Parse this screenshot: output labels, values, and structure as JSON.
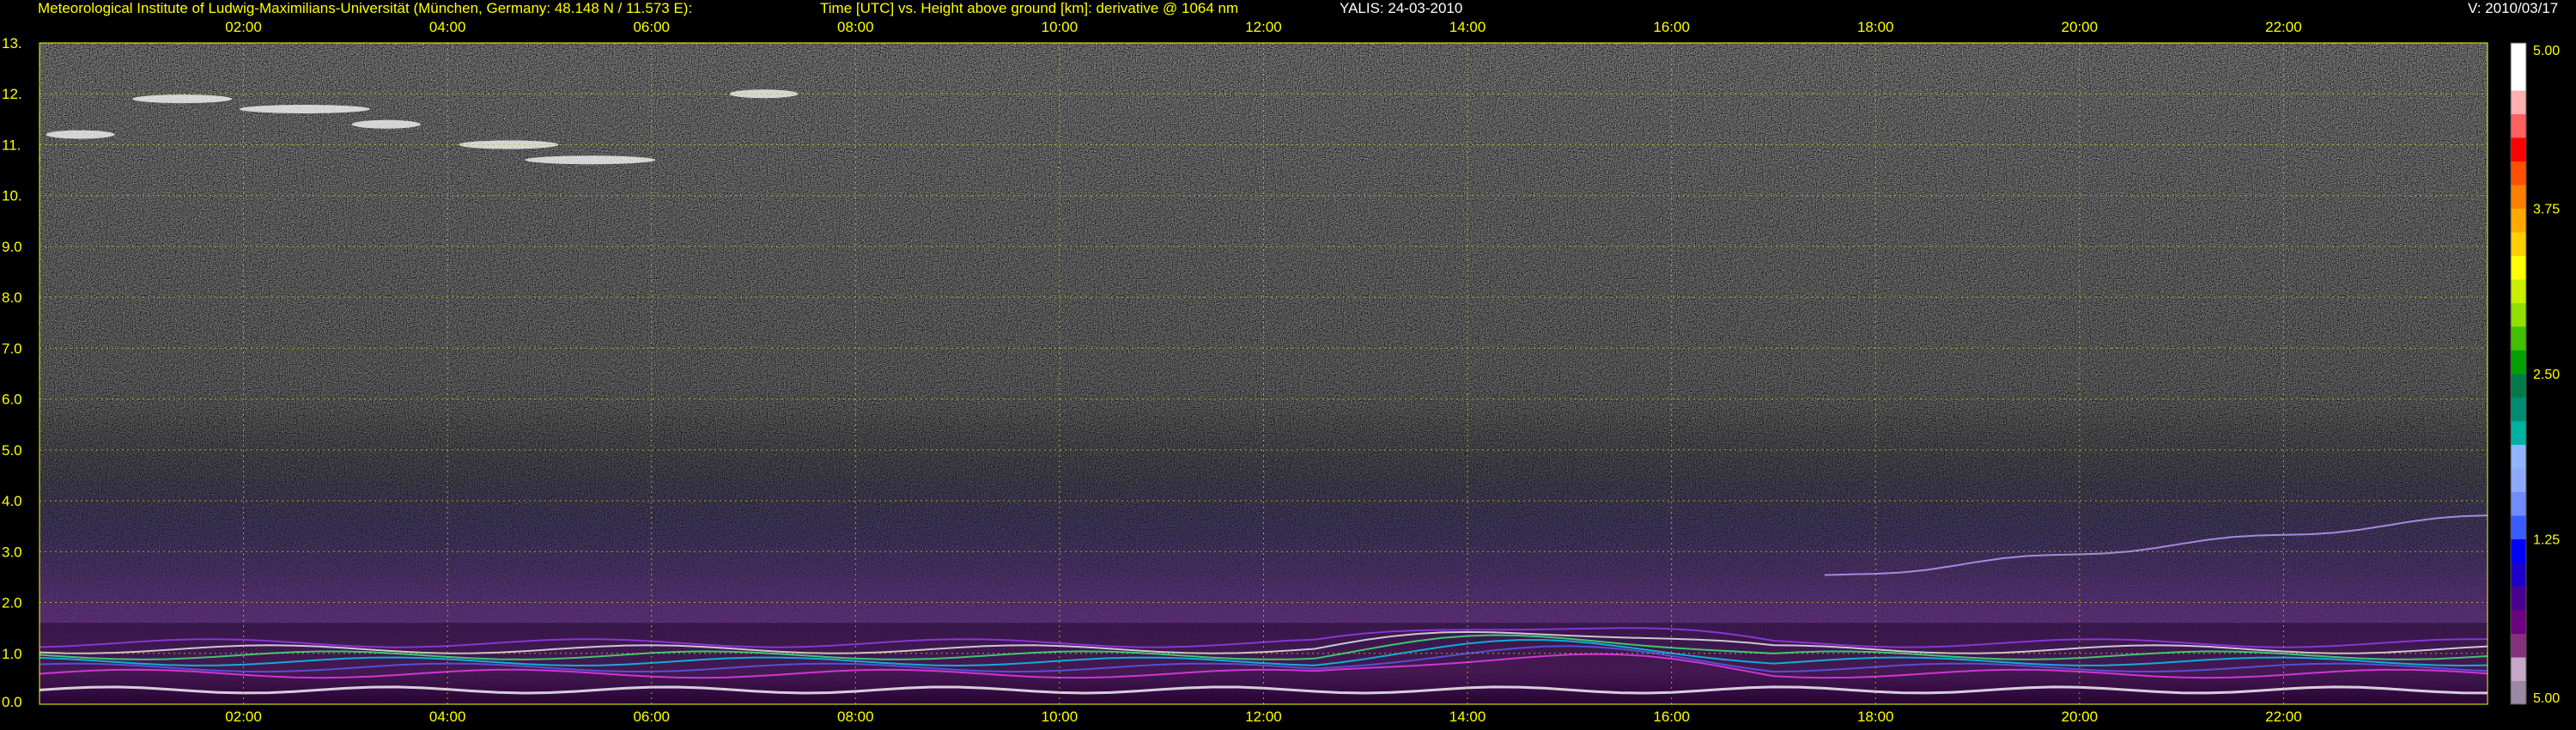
{
  "header": {
    "institute": "Meteorological Institute of Ludwig-Maximilians-Universität (München, Germany: 48.148 N / 11.573 E):",
    "description": "Time [UTC] vs. Height above ground [km]: derivative @ 1064 nm",
    "instrument": "YALIS: 24-03-2010",
    "version": "V: 2010/03/17"
  },
  "chart_data": {
    "type": "heatmap",
    "title": "Time [UTC] vs. Height above ground [km]: derivative @ 1064 nm",
    "xlabel": "Time [UTC]",
    "ylabel": "Height above ground [km]",
    "x_ticks": [
      "02:00",
      "04:00",
      "06:00",
      "08:00",
      "10:00",
      "12:00",
      "14:00",
      "16:00",
      "18:00",
      "20:00",
      "22:00"
    ],
    "y_ticks": [
      "0.0",
      "1.0",
      "2.0",
      "3.0",
      "4.0",
      "5.0",
      "6.0",
      "7.0",
      "8.0",
      "9.0",
      "10.",
      "11.",
      "12.",
      "13."
    ],
    "xlim_hours": [
      0,
      24
    ],
    "ylim_km": [
      0,
      13
    ],
    "grid": true,
    "colorbar": {
      "tick_labels": [
        "5.00",
        "3.75",
        "2.50",
        "1.25",
        "5.00"
      ],
      "colors": [
        "#9a8aa6",
        "#c7a8c9",
        "#84307a",
        "#6c007e",
        "#4a0090",
        "#1f00c8",
        "#0000ff",
        "#3a5cff",
        "#6f8bff",
        "#8fa8ff",
        "#90b4ff",
        "#00b0a0",
        "#008c70",
        "#007a4a",
        "#00a000",
        "#40c000",
        "#90e000",
        "#c8f000",
        "#ffff00",
        "#ffd000",
        "#ffaa00",
        "#ff8000",
        "#ff5000",
        "#ff0000",
        "#ff6060",
        "#ffb0b0",
        "#ffffff",
        "#ffffff"
      ]
    },
    "features": {
      "cirrus_clouds_km": [
        10.5,
        11.6
      ],
      "boundary_layer_top_km": 1.2,
      "aerosol_layer_evening_km": [
        2.5,
        3.8
      ]
    }
  }
}
